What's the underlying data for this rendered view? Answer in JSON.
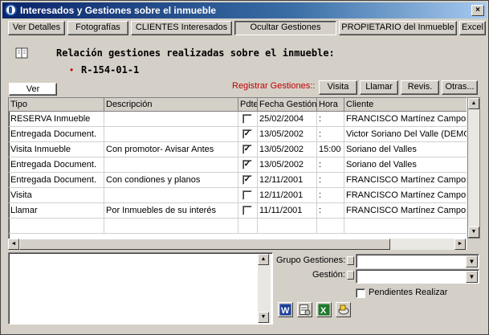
{
  "window": {
    "title": "Interesados y Gestiones sobre el inmueble",
    "close": "×"
  },
  "toolbar": {
    "buttons": [
      "Ver Detalles",
      "Fotografías",
      "CLIENTES Interesados",
      "Ocultar Gestiones",
      "PROPIETARIO del Inmueble",
      "Excel"
    ]
  },
  "header": {
    "heading": "Relación gestiones realizadas sobre el inmueble:",
    "bullet": "•",
    "reference": "R-154-01-1"
  },
  "actions": {
    "ver": "Ver",
    "registrar_label": "Registrar Gestiones::",
    "registrar_color": "#c00000",
    "buttons": [
      "Visita",
      "Llamar",
      "Revis.",
      "Otras..."
    ]
  },
  "table": {
    "columns": [
      "Tipo",
      "Descripción",
      "Pdte",
      "Fecha Gestión",
      "Hora",
      "Cliente"
    ],
    "rows": [
      {
        "tipo": "RESERVA Inmueble",
        "descripcion": "",
        "pdte": false,
        "fecha": "25/02/2004",
        "hora": ":",
        "cliente": "FRANCISCO Martínez Campos r"
      },
      {
        "tipo": "Entregada Document.",
        "descripcion": "",
        "pdte": true,
        "fecha": "13/05/2002",
        "hora": ":",
        "cliente": "Victor Soriano Del Valle (DEMO"
      },
      {
        "tipo": "Visita Inmueble",
        "descripcion": "Con promotor- Avisar Antes",
        "pdte": true,
        "fecha": "13/05/2002",
        "hora": "15:00",
        "cliente": "Soriano del Valles"
      },
      {
        "tipo": "Entregada Document.",
        "descripcion": "",
        "pdte": true,
        "fecha": "13/05/2002",
        "hora": ":",
        "cliente": "Soriano del Valles"
      },
      {
        "tipo": "Entregada Document.",
        "descripcion": "Con condiones y planos",
        "pdte": true,
        "fecha": "12/11/2001",
        "hora": ":",
        "cliente": "FRANCISCO Martínez Campos r"
      },
      {
        "tipo": "Visita",
        "descripcion": "",
        "pdte": false,
        "fecha": "12/11/2001",
        "hora": ":",
        "cliente": "FRANCISCO Martínez Campos r"
      },
      {
        "tipo": "Llamar",
        "descripcion": "Por Inmuebles de su interés",
        "pdte": false,
        "fecha": "11/11/2001",
        "hora": ":",
        "cliente": "FRANCISCO Martínez Campos r"
      }
    ]
  },
  "filters": {
    "grupo_label": "Grupo Gestiones:",
    "grupo_value": "",
    "gestion_label": "Gestión:",
    "gestion_value": "",
    "pendientes_label": "Pendientes Realizar",
    "pendientes_checked": false
  },
  "tools": [
    "word-icon",
    "report-icon",
    "excel-icon",
    "export-icon"
  ],
  "icons": {
    "check": "✓",
    "up": "▲",
    "down": "▼",
    "left": "◄",
    "right": "►"
  }
}
